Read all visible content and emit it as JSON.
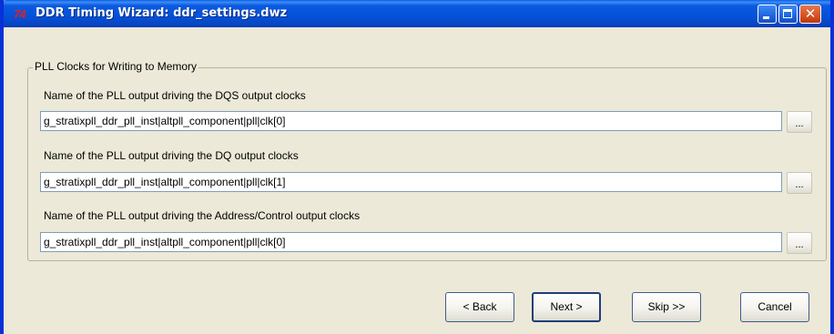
{
  "window": {
    "title": "DDR Timing Wizard: ddr_settings.dwz",
    "app_icon_text": "74",
    "minimize_glyph": "",
    "maximize_glyph": "",
    "close_glyph": "✕"
  },
  "group": {
    "legend": "PLL Clocks for Writing to Memory",
    "fields": [
      {
        "label": "Name of the PLL output driving the DQS output clocks",
        "value": "g_stratixpll_ddr_pll_inst|altpll_component|pll|clk[0]",
        "browse_label": "..."
      },
      {
        "label": "Name of the PLL output driving the DQ output clocks",
        "value": "g_stratixpll_ddr_pll_inst|altpll_component|pll|clk[1]",
        "browse_label": "..."
      },
      {
        "label": "Name of the PLL output driving the Address/Control output clocks",
        "value": "g_stratixpll_ddr_pll_inst|altpll_component|pll|clk[0]",
        "browse_label": "..."
      }
    ]
  },
  "buttons": {
    "back": "< Back",
    "next": "Next >",
    "skip": "Skip >>",
    "cancel": "Cancel"
  },
  "colors": {
    "titlebar": "#0551d8",
    "window_border": "#0831d9",
    "face": "#ece9d8",
    "close_button": "#d14c1d"
  }
}
